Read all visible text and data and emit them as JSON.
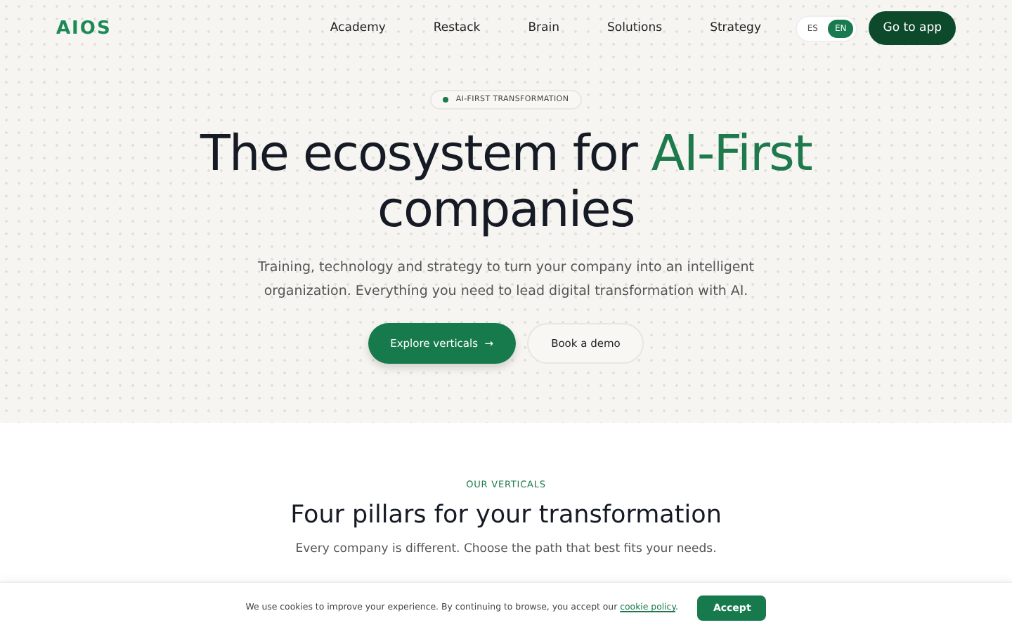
{
  "logo": "AIOS",
  "nav": [
    {
      "label": "Academy"
    },
    {
      "label": "Restack"
    },
    {
      "label": "Brain"
    },
    {
      "label": "Solutions"
    },
    {
      "label": "Strategy"
    }
  ],
  "languages": [
    {
      "label": "ES",
      "selected": false
    },
    {
      "label": "EN",
      "selected": true
    }
  ],
  "cta": "Go to app",
  "hero": {
    "badge": "AI-FIRST TRANSFORMATION",
    "headline_start": "The ecosystem for ",
    "headline_accent": "AI-First",
    "headline_end": "companies",
    "subtitle": "Training, technology and strategy to turn your company into an intelligent organization. Everything you need to lead digital transformation with AI.",
    "primary": {
      "label": "Explore verticals",
      "arrow": "→"
    },
    "secondary": "Book a demo"
  },
  "verticals": {
    "eyebrow": "OUR VERTICALS",
    "title": "Four pillars for your transformation",
    "subtitle": "Every company is different. Choose the path that best fits your needs."
  },
  "cookie": {
    "text": "We use cookies to improve your experience. By continuing to browse, you accept our ",
    "link": "cookie policy",
    "end": ".",
    "button": "Accept"
  }
}
